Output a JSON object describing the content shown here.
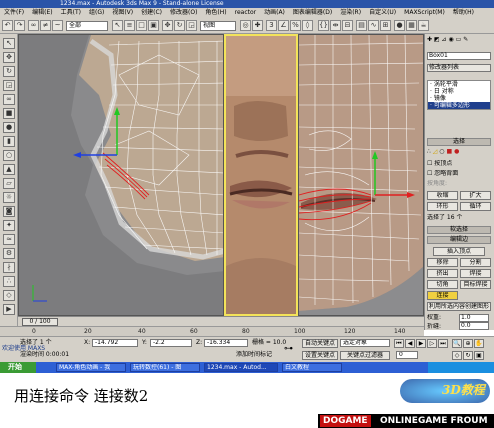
{
  "app": {
    "title": "1234.max - Autodesk 3ds Max 9 - Stand-alone License"
  },
  "menu": [
    "文件(F)",
    "编辑(E)",
    "工具(T)",
    "组(G)",
    "视图(V)",
    "创建(C)",
    "修改器(O)",
    "角色(H)",
    "reactor",
    "动画(A)",
    "图表编辑器(D)",
    "渲染(R)",
    "自定义(U)",
    "MAXScript(M)",
    "帮助(H)"
  ],
  "toolbar": {
    "selection_filter": "全部",
    "coord_system": "视图"
  },
  "command_panel": {
    "object_name": "Box01",
    "modifier_list_label": "修改器列表",
    "stack_items": [
      {
        "label": "· 涡轮平滑",
        "selected": false
      },
      {
        "label": "· 日 对称",
        "selected": false
      },
      {
        "label": "   · 镜像",
        "selected": false
      },
      {
        "label": "· 可编辑多边形",
        "selected": true
      }
    ],
    "rollout_selection": "选择",
    "by_vertex": "按顶点",
    "ignore_backfacing": "忽略背面",
    "by_angle_label": "按角度:",
    "shrink": "收缩",
    "grow": "扩大",
    "ring": "环形",
    "loop": "循环",
    "selected_count": "选择了 16 个",
    "rollout_soft": "软选择",
    "rollout_edit": "编辑边",
    "insert_vertex": "插入顶点",
    "remove": "移除",
    "split": "分割",
    "extrude": "挤出",
    "weld": "焊接",
    "chamfer": "切角",
    "target_weld": "目标焊接",
    "connect": "连接",
    "create_shape": "利用所选内容创建图形",
    "weight_label": "权重:",
    "weight_value": "1.0",
    "crease_label": "折缝:",
    "crease_value": "0.0"
  },
  "timeline": {
    "slider": "0 / 100",
    "ticks": [
      "0",
      "20",
      "40",
      "60",
      "80",
      "100",
      "120",
      "140"
    ]
  },
  "status": {
    "selected": "选择了 1 个",
    "x_label": "X:",
    "x_value": "-14.792",
    "y_label": "Y:",
    "y_value": "-2.2",
    "z_label": "Z:",
    "z_value": "-16.334",
    "grid": "栅格 = 10.0",
    "auto_key": "自动关键点",
    "key_filter": "选定对象",
    "set_key": "设置关键点",
    "key_filters": "关键点过滤器",
    "render_time": "渲染时间 0:00:01",
    "add_time_tag": "添加时间标记",
    "welcome": "欢迎使用 MAXS"
  },
  "taskbar": {
    "start": "开始",
    "items": [
      "MAX-角色动画 - 我",
      "玩转数控(61) - 图",
      "1234.max - Autod...",
      "白文教程"
    ]
  },
  "caption": {
    "text": "用连接命令   连接数2"
  },
  "watermark": {
    "text": "3D教程",
    "brand": "DOGAME",
    "sub": "ONLINEGAME FROUM"
  },
  "colors": {
    "title_bg": "#2a54a8",
    "ui_gray": "#d4d0c8",
    "taskbar": "#2d5fd4",
    "active_viewport_border": "#f3e35a",
    "wire": "#ffffff",
    "selected_edges": "#e02020"
  }
}
